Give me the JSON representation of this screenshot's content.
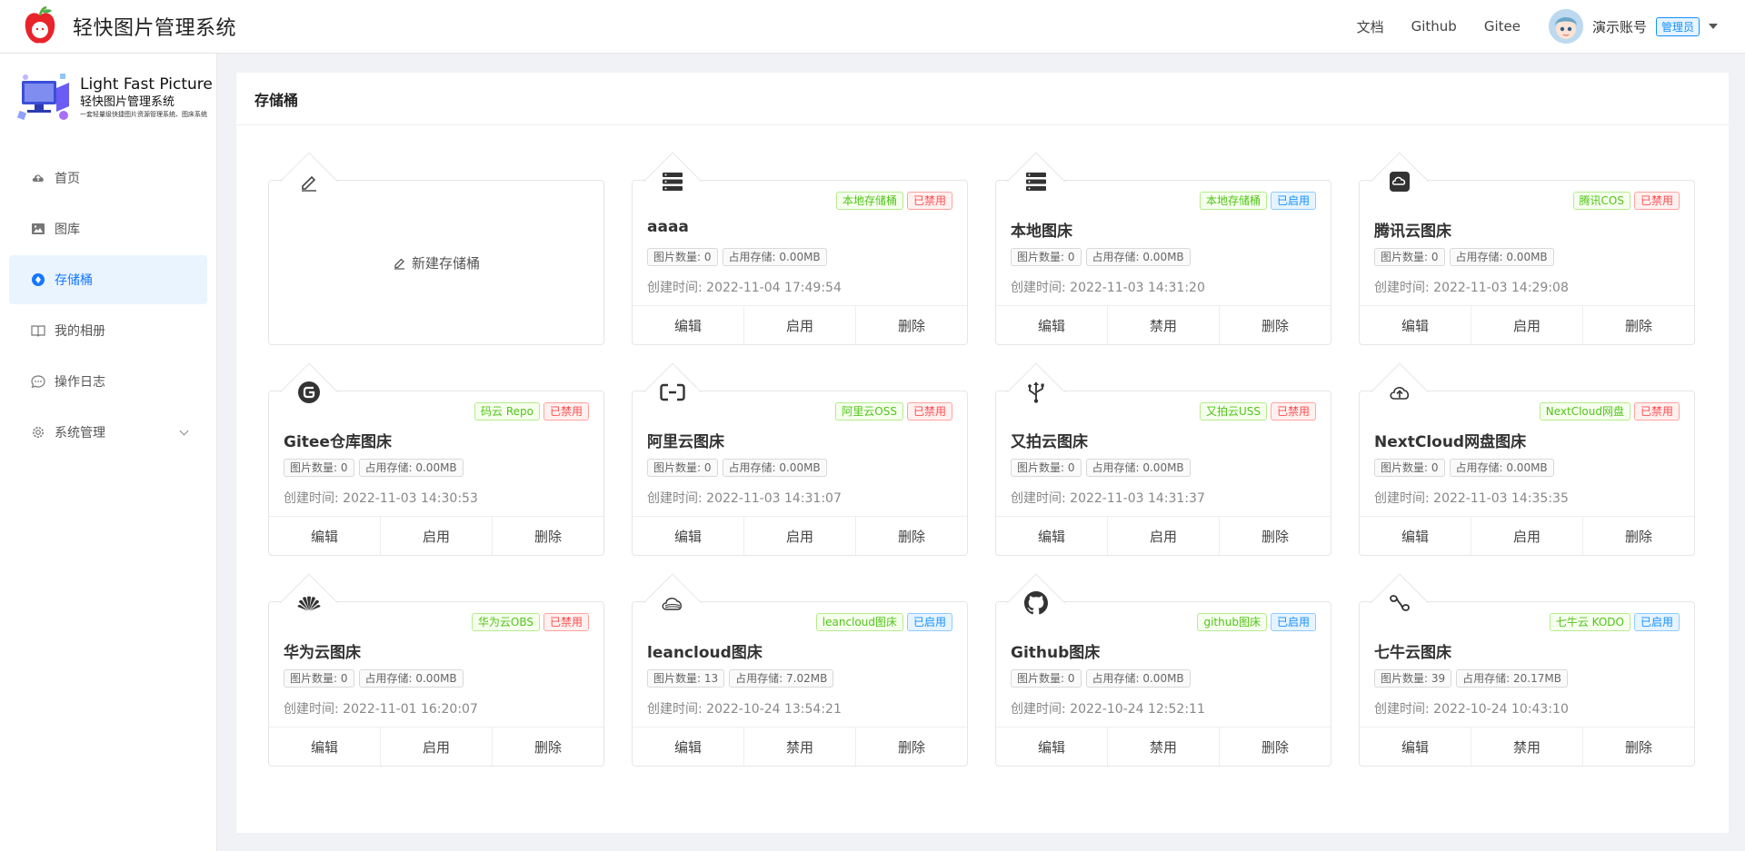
{
  "header": {
    "title": "轻快图片管理系统",
    "nav": [
      "文档",
      "Github",
      "Gitee"
    ],
    "username": "演示账号",
    "role": "管理员"
  },
  "sidebar": {
    "logo": {
      "en": "Light Fast Picture",
      "cn": "轻快图片管理系统",
      "sub": "一套轻量级快捷图片资源管理系统、图床系统"
    },
    "items": [
      {
        "label": "首页",
        "icon": "cloud-upload-icon"
      },
      {
        "label": "图库",
        "icon": "image-icon"
      },
      {
        "label": "存储桶",
        "icon": "storage-icon",
        "active": true
      },
      {
        "label": "我的相册",
        "icon": "book-icon"
      },
      {
        "label": "操作日志",
        "icon": "message-icon"
      },
      {
        "label": "系统管理",
        "icon": "gear-icon",
        "expandable": true
      }
    ]
  },
  "panel": {
    "title": "存储桶",
    "new_bucket_label": "新建存储桶"
  },
  "labels": {
    "edit": "编辑",
    "enable": "启用",
    "disable": "禁用",
    "delete": "删除"
  },
  "buckets": [
    {
      "name": "aaaa",
      "type": "本地存储桶",
      "status": "已禁用",
      "images": "图片数量: 0",
      "storage": "占用存储: 0.00MB",
      "created": "创建时间: 2022-11-04 17:49:54",
      "toggle": "启用",
      "icon": "server-icon"
    },
    {
      "name": "本地图床",
      "type": "本地存储桶",
      "status": "已启用",
      "images": "图片数量: 0",
      "storage": "占用存储: 0.00MB",
      "created": "创建时间: 2022-11-03 14:31:20",
      "toggle": "禁用",
      "icon": "server-icon"
    },
    {
      "name": "腾讯云图床",
      "type": "腾讯COS",
      "status": "已禁用",
      "images": "图片数量: 0",
      "storage": "占用存储: 0.00MB",
      "created": "创建时间: 2022-11-03 14:29:08",
      "toggle": "启用",
      "icon": "tencent-cloud-icon"
    },
    {
      "name": "Gitee仓库图床",
      "type": "码云 Repo",
      "status": "已禁用",
      "images": "图片数量: 0",
      "storage": "占用存储: 0.00MB",
      "created": "创建时间: 2022-11-03 14:30:53",
      "toggle": "启用",
      "icon": "gitee-icon"
    },
    {
      "name": "阿里云图床",
      "type": "阿里云OSS",
      "status": "已禁用",
      "images": "图片数量: 0",
      "storage": "占用存储: 0.00MB",
      "created": "创建时间: 2022-11-03 14:31:07",
      "toggle": "启用",
      "icon": "aliyun-icon"
    },
    {
      "name": "又拍云图床",
      "type": "又拍云USS",
      "status": "已禁用",
      "images": "图片数量: 0",
      "storage": "占用存储: 0.00MB",
      "created": "创建时间: 2022-11-03 14:31:37",
      "toggle": "启用",
      "icon": "usb-icon"
    },
    {
      "name": "NextCloud网盘图床",
      "type": "NextCloud网盘",
      "status": "已禁用",
      "images": "图片数量: 0",
      "storage": "占用存储: 0.00MB",
      "created": "创建时间: 2022-11-03 14:35:35",
      "toggle": "启用",
      "icon": "cloud-upload-icon"
    },
    {
      "name": "华为云图床",
      "type": "华为云OBS",
      "status": "已禁用",
      "images": "图片数量: 0",
      "storage": "占用存储: 0.00MB",
      "created": "创建时间: 2022-11-01 16:20:07",
      "toggle": "启用",
      "icon": "huawei-icon"
    },
    {
      "name": "leancloud图床",
      "type": "leancloud图床",
      "status": "已启用",
      "images": "图片数量: 13",
      "storage": "占用存储: 7.02MB",
      "created": "创建时间: 2022-10-24 13:54:21",
      "toggle": "禁用",
      "icon": "leancloud-icon"
    },
    {
      "name": "Github图床",
      "type": "github图床",
      "status": "已启用",
      "images": "图片数量: 0",
      "storage": "占用存储: 0.00MB",
      "created": "创建时间: 2022-10-24 12:52:11",
      "toggle": "禁用",
      "icon": "github-icon"
    },
    {
      "name": "七牛云图床",
      "type": "七牛云 KODO",
      "status": "已启用",
      "images": "图片数量: 39",
      "storage": "占用存储: 20.17MB",
      "created": "创建时间: 2022-10-24 10:43:10",
      "toggle": "禁用",
      "icon": "qiniu-icon"
    }
  ],
  "colors": {
    "accent": "#1677ff",
    "type_tag": "#52c41a",
    "disabled_tag": "#ff4d4f",
    "enabled_tag": "#1890ff"
  }
}
